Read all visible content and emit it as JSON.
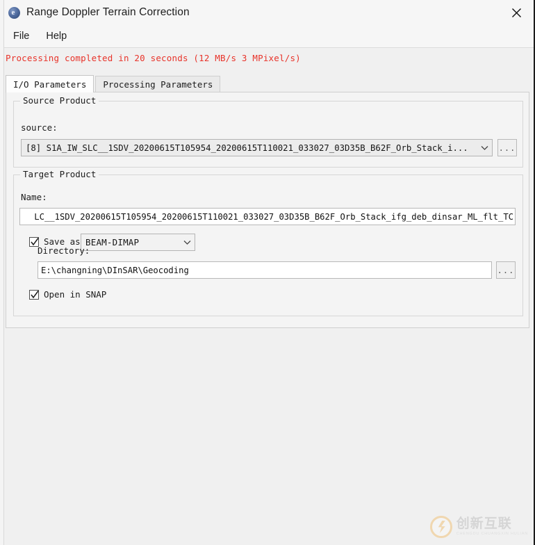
{
  "window": {
    "title": "Range Doppler Terrain Correction",
    "app_icon": "snap-globe-icon",
    "close_icon": "close-icon"
  },
  "menubar": {
    "items": [
      {
        "label": "File"
      },
      {
        "label": "Help"
      }
    ]
  },
  "status": {
    "message": "Processing completed in 20 seconds (12 MB/s 3 MPixel/s)",
    "color": "#e8332a"
  },
  "tabs": [
    {
      "label": "I/O Parameters",
      "active": true
    },
    {
      "label": "Processing Parameters",
      "active": false
    }
  ],
  "source_product": {
    "legend": "Source Product",
    "source_label": "source:",
    "source_value": "[8] S1A_IW_SLC__1SDV_20200615T105954_20200615T110021_033027_03D35B_B62F_Orb_Stack_i...",
    "browse_label": "...",
    "dropdown_icon": "chevron-down-icon"
  },
  "target_product": {
    "legend": "Target Product",
    "name_label": "Name:",
    "name_value": "LC__1SDV_20200615T105954_20200615T110021_033027_03D35B_B62F_Orb_Stack_ifg_deb_dinsar_ML_flt_TC",
    "save_as_label": "Save as:",
    "save_as_checked": true,
    "format_value": "BEAM-DIMAP",
    "format_icon": "chevron-down-icon",
    "directory_label": "Directory:",
    "directory_value": "E:\\changning\\DInSAR\\Geocoding",
    "browse_label": "...",
    "open_in_snap_label": "Open in SNAP",
    "open_in_snap_checked": true
  },
  "watermark": {
    "cn_text": "创新互联",
    "en_text": "CHENGDU CHUANGXIN HULIAN"
  }
}
